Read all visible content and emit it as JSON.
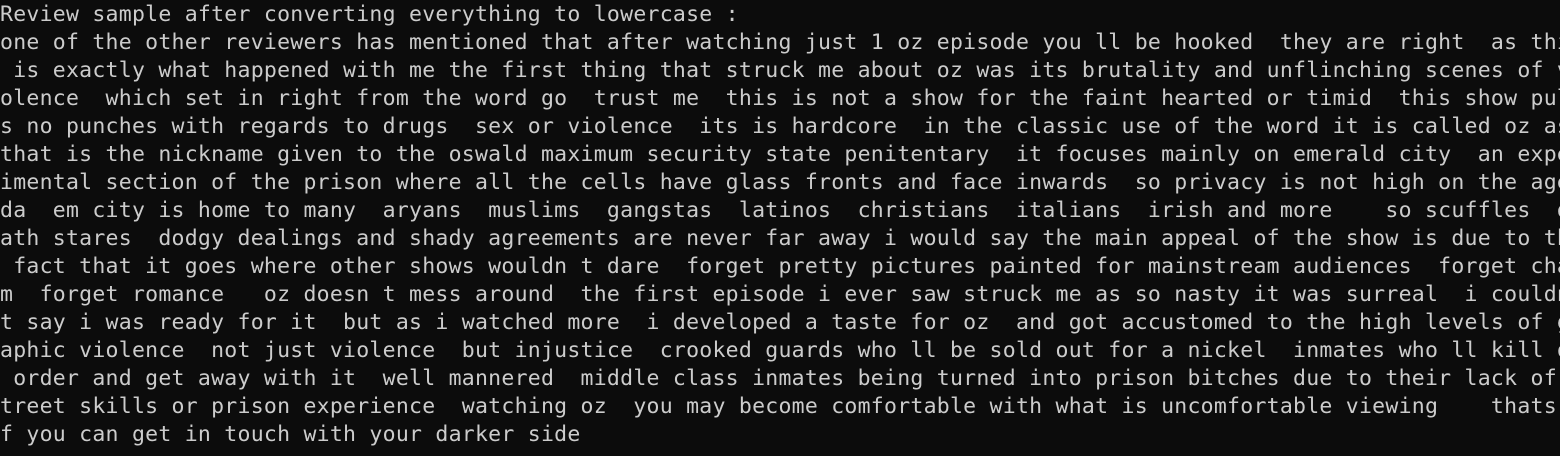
{
  "console": {
    "colors": {
      "background": "#0c0c0c",
      "text": "#cccccc"
    },
    "lines": [
      "Review sample after converting everything to lowercase :",
      "one of the other reviewers has mentioned that after watching just 1 oz episode you ll be hooked  they are right  as this",
      " is exactly what happened with me the first thing that struck me about oz was its brutality and unflinching scenes of vi",
      "olence  which set in right from the word go  trust me  this is not a show for the faint hearted or timid  this show pull",
      "s no punches with regards to drugs  sex or violence  its is hardcore  in the classic use of the word it is called oz as ",
      "that is the nickname given to the oswald maximum security state penitentary  it focuses mainly on emerald city  an exper",
      "imental section of the prison where all the cells have glass fronts and face inwards  so privacy is not high on the agen",
      "da  em city is home to many  aryans  muslims  gangstas  latinos  christians  italians  irish and more    so scuffles  de",
      "ath stares  dodgy dealings and shady agreements are never far away i would say the main appeal of the show is due to the",
      " fact that it goes where other shows wouldn t dare  forget pretty pictures painted for mainstream audiences  forget char",
      "m  forget romance   oz doesn t mess around  the first episode i ever saw struck me as so nasty it was surreal  i couldn ",
      "t say i was ready for it  but as i watched more  i developed a taste for oz  and got accustomed to the high levels of gr",
      "aphic violence  not just violence  but injustice  crooked guards who ll be sold out for a nickel  inmates who ll kill on",
      " order and get away with it  well mannered  middle class inmates being turned into prison bitches due to their lack of s",
      "treet skills or prison experience  watching oz  you may become comfortable with what is uncomfortable viewing    thats i",
      "f you can get in touch with your darker side"
    ]
  }
}
